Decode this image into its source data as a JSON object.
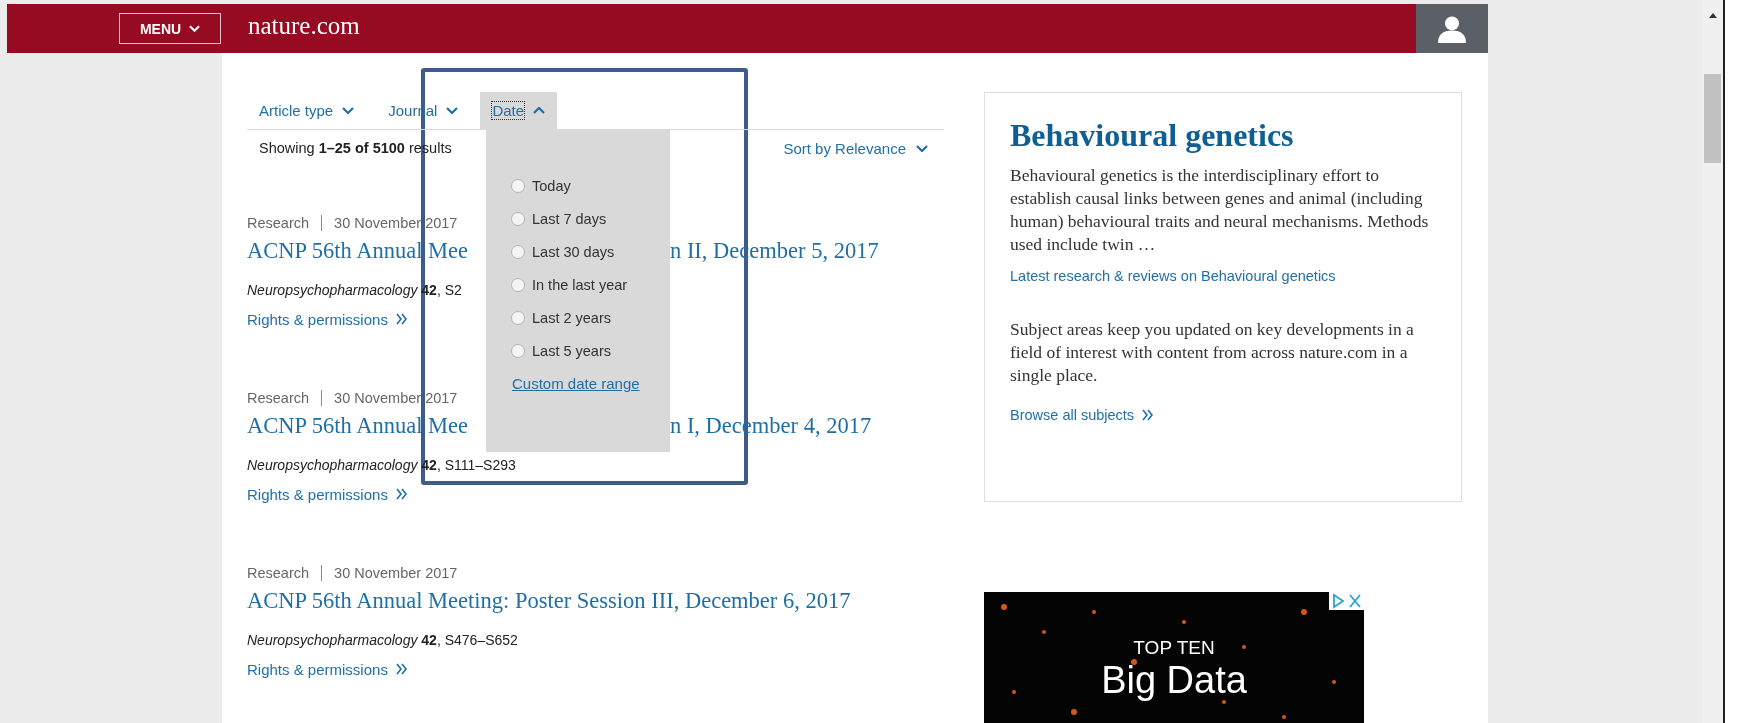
{
  "header": {
    "menu_button": "MENU",
    "logo": "nature.com"
  },
  "filters": [
    {
      "label": "Article type",
      "selected": false
    },
    {
      "label": "Journal",
      "selected": false
    },
    {
      "label": "Date",
      "selected": true
    }
  ],
  "results_summary": "Showing **1–25 of 5100** results",
  "sort": "Sort by Relevance",
  "date_menu": {
    "options": [
      {
        "label": "Today",
        "selected": false
      },
      {
        "label": "Last 7 days",
        "selected": false
      },
      {
        "label": "Last 30 days",
        "selected": false
      },
      {
        "label": "In the last year",
        "selected": false
      },
      {
        "label": "Last 2 years",
        "selected": false
      },
      {
        "label": "Last 5 years",
        "selected": false
      }
    ],
    "link": "Custom date range"
  },
  "results": [
    {
      "category": "Research",
      "date": "30 November 2017",
      "title_parts": [
        "ACNP 56th Annual Mee",
        "n II, December 5, 2017"
      ],
      "journal": "*Neuropsychopharmacology* **42**, S2",
      "link": "Rights & permissions"
    },
    {
      "category": "Research",
      "date": "30 November 2017",
      "title_parts": [
        "ACNP 56th Annual Mee",
        "n I, December 4, 2017"
      ],
      "journal": "*Neuropsychopharmacology* **42**, S111–S293",
      "link": "Rights & permissions"
    },
    {
      "category": "Research",
      "date": "30 November 2017",
      "title_parts": [
        "ACNP 56th Annual Meeting: Poster Session III, December 6, 2017"
      ],
      "journal": "*Neuropsychopharmacology* **42**, S476–S652",
      "link": "Rights & permissions"
    }
  ],
  "subject_card": {
    "title": "Behavioural genetics",
    "description": "Behavioural genetics is the interdisciplinary effort to establish causal links between genes and animal (including human) behavioural traits and neural mechanisms. Methods used include twin …",
    "latest_link": "Latest research & reviews on Behavioural genetics",
    "note": "Subject areas keep you updated on key developments in a field of interest with content from across nature.com in a single place.",
    "browse_link": "Browse all subjects"
  },
  "ad": {
    "kind": "picture",
    "lines": [
      "TOP TEN",
      "Big Data"
    ]
  }
}
